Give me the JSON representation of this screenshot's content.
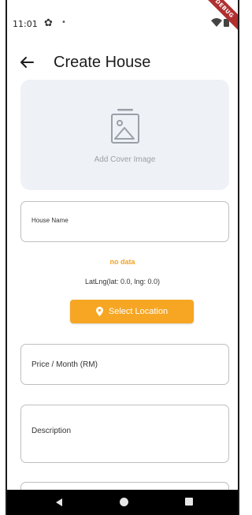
{
  "status_bar": {
    "time": "11:01",
    "debug_label": "DEBUG"
  },
  "app_bar": {
    "title": "Create House"
  },
  "cover": {
    "label": "Add Cover Image"
  },
  "form": {
    "house_name_placeholder": "House Name",
    "location_status": "no data",
    "latlng_text": "LatLng(lat: 0.0, lng: 0.0)",
    "select_location_label": "Select Location",
    "price_placeholder": "Price / Month (RM)",
    "description_placeholder": "Description"
  },
  "colors": {
    "accent": "#f6a623",
    "cover_bg": "#eef2f7",
    "nav_bg": "#000000"
  },
  "icons": {
    "back": "arrow-left-icon",
    "cover": "image-icon",
    "location": "pin-icon",
    "settings": "gear-icon"
  }
}
